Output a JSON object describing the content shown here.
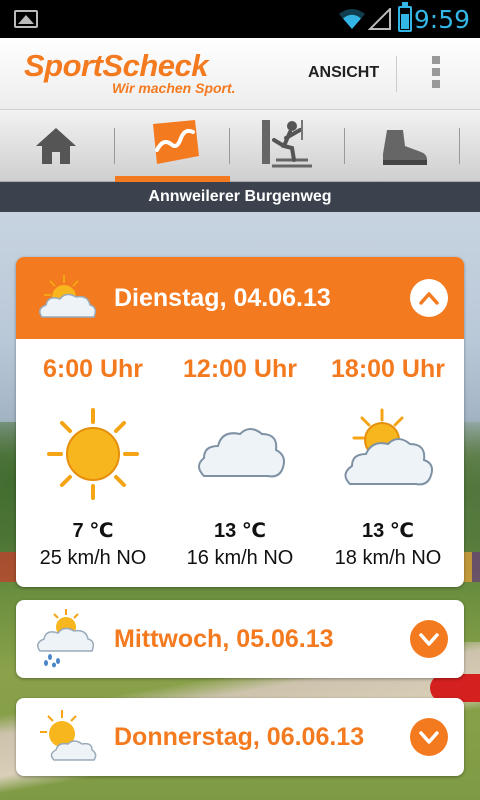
{
  "status_bar": {
    "time": "9:59",
    "icons": [
      "gallery-icon",
      "wifi-icon",
      "signal-icon",
      "battery-icon"
    ]
  },
  "header": {
    "brand": "SportScheck",
    "slogan": "Wir machen Sport.",
    "view_button": "ANSICHT",
    "brand_color": "#f47a20"
  },
  "tabs": [
    {
      "name": "home",
      "icon": "home-icon",
      "active": false
    },
    {
      "name": "route",
      "icon": "route-map-icon",
      "active": true
    },
    {
      "name": "climbing",
      "icon": "climbing-icon",
      "active": false
    },
    {
      "name": "boot",
      "icon": "hiking-boot-icon",
      "active": false
    }
  ],
  "location": "Annweilerer Burgenweg",
  "forecast": {
    "day1": {
      "title": "Dienstag, 04.06.13",
      "icon": "partly-cloudy-icon",
      "expanded": true,
      "slots": [
        {
          "time": "6:00 Uhr",
          "icon": "sun-icon",
          "temp": "7 ℃",
          "wind": "25 km/h NO"
        },
        {
          "time": "12:00 Uhr",
          "icon": "cloud-icon",
          "temp": "13 ℃",
          "wind": "16 km/h NO"
        },
        {
          "time": "18:00 Uhr",
          "icon": "partly-cloudy-icon",
          "temp": "13 ℃",
          "wind": "18 km/h NO"
        }
      ]
    },
    "day2": {
      "title": "Mittwoch, 05.06.13",
      "icon": "rain-showers-icon",
      "expanded": false
    },
    "day3": {
      "title": "Donnerstag, 06.06.13",
      "icon": "partly-cloudy-icon",
      "expanded": false
    }
  }
}
